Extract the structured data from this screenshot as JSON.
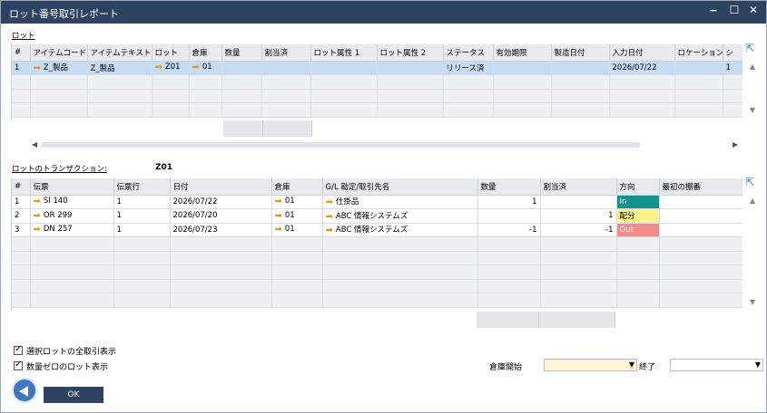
{
  "window": {
    "title": "ロット番号取引レポート",
    "minimize": "▁",
    "maximize": "☐",
    "close": "✕"
  },
  "lots": {
    "label": "ロット",
    "columns": [
      "#",
      "アイテムコード",
      "アイテムテキスト",
      "ロット",
      "倉庫",
      "数量",
      "割当済",
      "ロット属性 1",
      "ロット属性 2",
      "ステータス",
      "有効期限",
      "製造日付",
      "入力日付",
      "ロケーション",
      "シ"
    ],
    "rows": [
      {
        "no": "1",
        "item_code": "Z_製品",
        "item_text": "Z_製品",
        "lot": "Z01",
        "warehouse": "01",
        "qty": "",
        "allocated": "",
        "attr1": "",
        "attr2": "",
        "status": "リリース済",
        "expiry": "",
        "mfg": "",
        "input_date": "2026/07/22",
        "location": "",
        "s": "1"
      }
    ]
  },
  "transactions": {
    "label": "ロットのトランザクション:",
    "lot_value": "Z01",
    "columns": [
      "#",
      "伝票",
      "伝票行",
      "日付",
      "倉庫",
      "G/L 勘定/取引先名",
      "数量",
      "割当済",
      "方向",
      "最初の棚番"
    ],
    "rows": [
      {
        "no": "1",
        "doc": "SI 140",
        "line": "1",
        "date": "2026/07/22",
        "warehouse": "01",
        "account": "仕掛品",
        "qty": "1",
        "allocated": "",
        "direction": "In",
        "direction_color": "#13938c",
        "shelf": ""
      },
      {
        "no": "2",
        "doc": "OR 299",
        "line": "1",
        "date": "2026/07/20",
        "warehouse": "01",
        "account": "ABC 情報システムズ",
        "qty": "",
        "allocated": "1",
        "direction": "配分",
        "direction_color": "#fbf38a",
        "shelf": ""
      },
      {
        "no": "3",
        "doc": "DN 257",
        "line": "1",
        "date": "2026/07/23",
        "warehouse": "01",
        "account": "ABC 情報システムズ",
        "qty": "-1",
        "allocated": "-1",
        "direction": "Out",
        "direction_color": "#f28b8b",
        "shelf": ""
      }
    ]
  },
  "options": {
    "show_all": "選択ロットの全取引表示",
    "show_zero": "数量ゼロのロット表示"
  },
  "filter": {
    "warehouse_from": "倉庫開始",
    "to": "終了",
    "from_value": "",
    "to_value": ""
  },
  "buttons": {
    "ok": "OK"
  },
  "colors": {
    "titlebar": "#2e4361",
    "selected_row": "#c6dcf5",
    "input_highlight": "#fff3d6"
  }
}
